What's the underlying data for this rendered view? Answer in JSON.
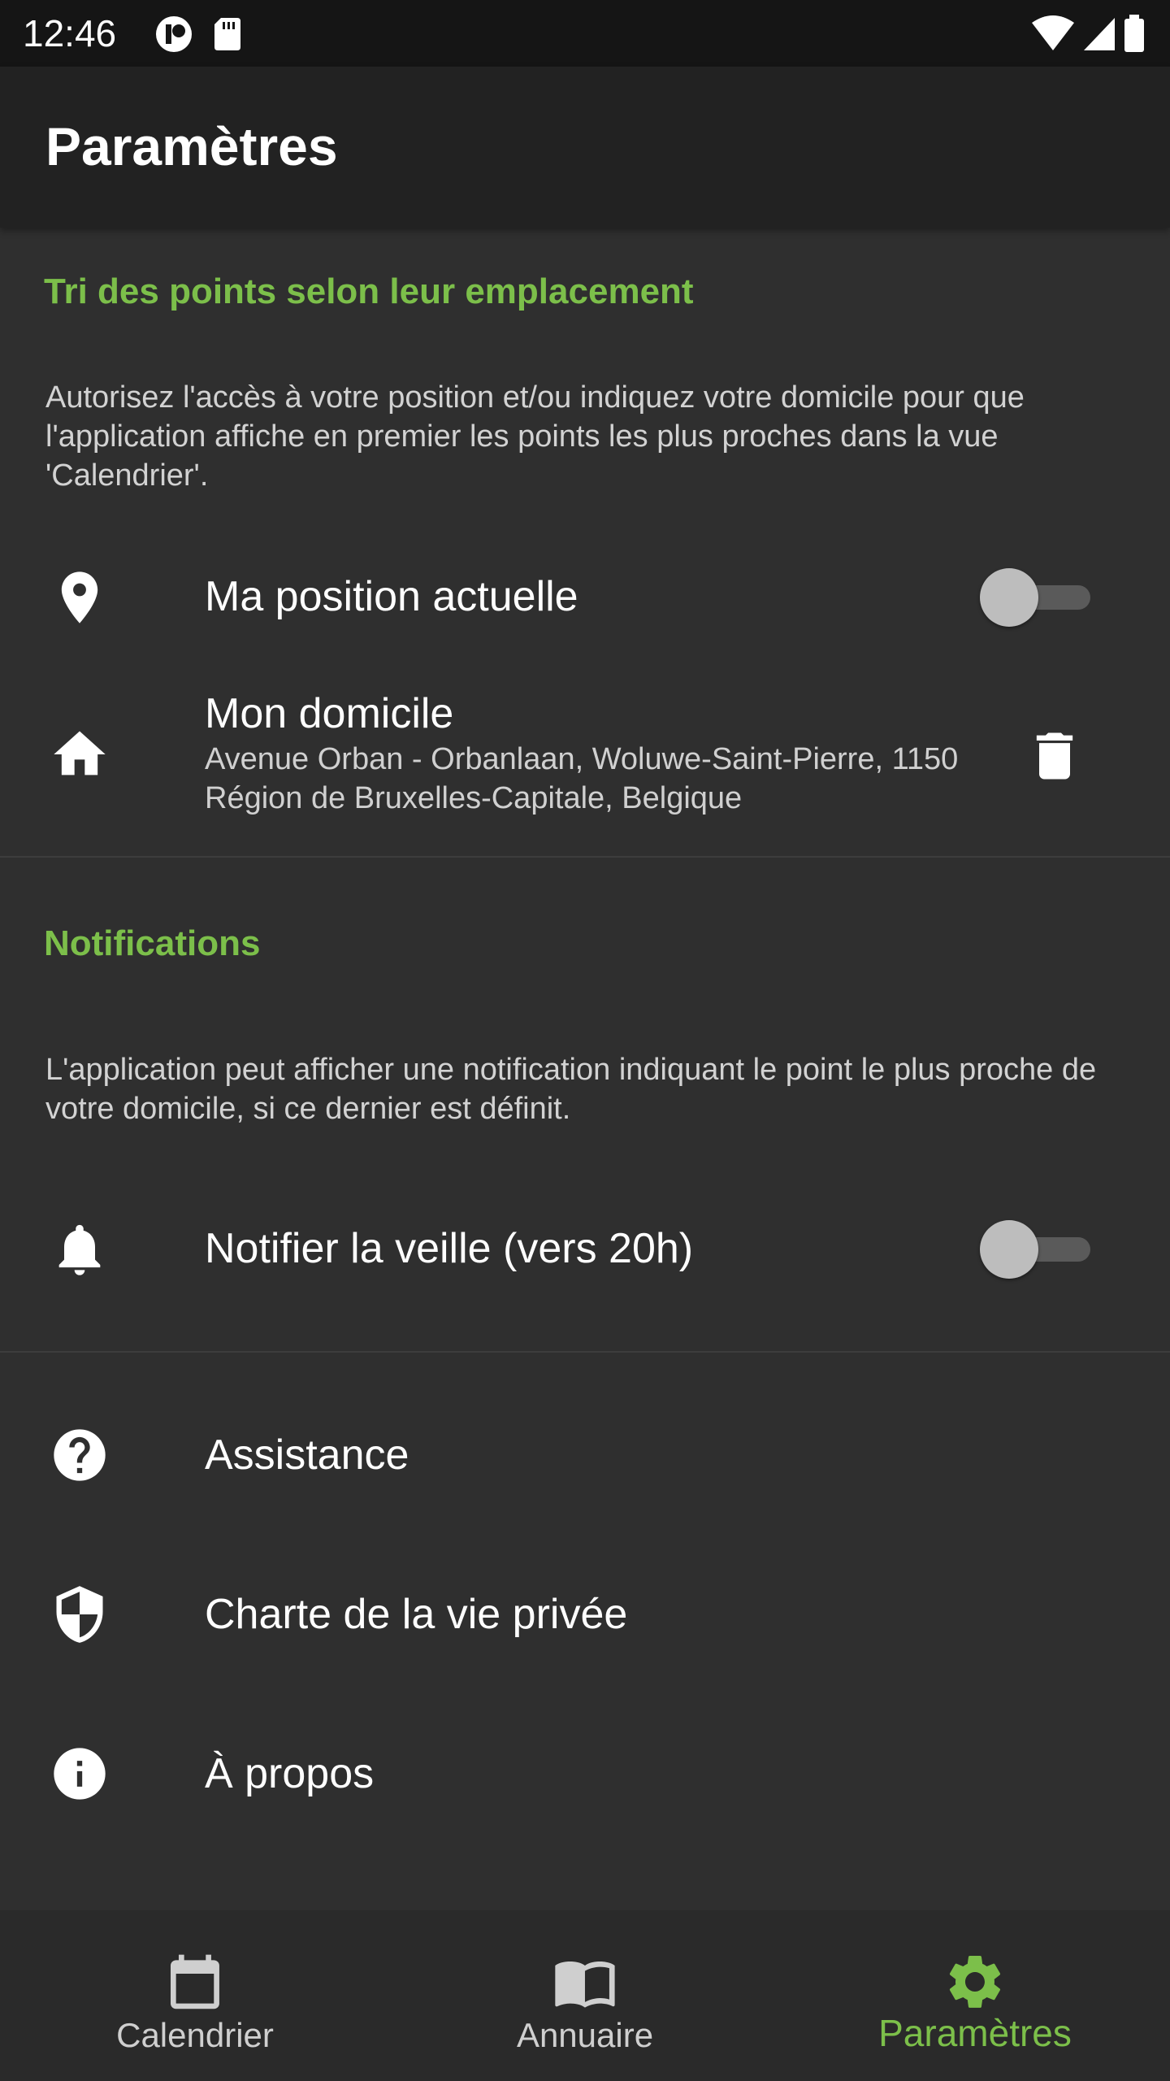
{
  "status_bar": {
    "time": "12:46",
    "icons": [
      "notification-app-icon",
      "sd-card-icon",
      "wifi-icon",
      "signal-icon",
      "battery-icon"
    ]
  },
  "app_bar": {
    "title": "Paramètres"
  },
  "location_section": {
    "title": "Tri des points selon leur emplacement",
    "description": "Autorisez l'accès à votre position et/ou indiquez votre domicile pour que l'application affiche en premier les points les plus proches dans la vue 'Calendrier'.",
    "current_position": {
      "label": "Ma position actuelle",
      "icon": "location-pin-icon",
      "enabled": false
    },
    "home": {
      "label": "Mon domicile",
      "address": "Avenue Orban - Orbanlaan, Woluwe-Saint-Pierre, 1150 Région de Bruxelles-Capitale, Belgique",
      "icon": "home-icon",
      "action_icon": "delete-icon"
    }
  },
  "notifications_section": {
    "title": "Notifications",
    "description": "L'application peut afficher une notification indiquant le point le plus proche de votre domicile, si ce dernier est définit.",
    "notify": {
      "label": "Notifier la veille (vers 20h)",
      "icon": "bell-icon",
      "enabled": false
    }
  },
  "links": [
    {
      "label": "Assistance",
      "icon": "help-icon"
    },
    {
      "label": "Charte de la vie privée",
      "icon": "shield-icon"
    },
    {
      "label": "À propos",
      "icon": "info-icon"
    }
  ],
  "bottom_nav": {
    "items": [
      {
        "label": "Calendrier",
        "icon": "calendar-icon",
        "active": false
      },
      {
        "label": "Annuaire",
        "icon": "book-icon",
        "active": false
      },
      {
        "label": "Paramètres",
        "icon": "settings-gear-icon",
        "active": true
      }
    ]
  },
  "colors": {
    "accent": "#7cbf4a",
    "background": "#2f2f2f",
    "app_bar": "#222222",
    "status_bar": "#151515",
    "bottom_nav": "#2a2a2a"
  }
}
